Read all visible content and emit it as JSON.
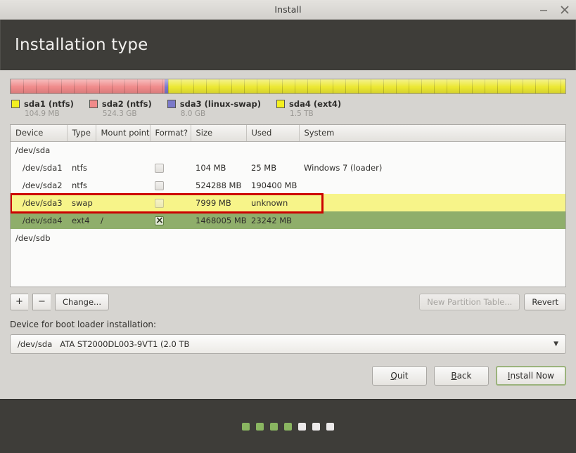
{
  "window": {
    "title": "Install",
    "controls": [
      {
        "name": "minimize",
        "glyph": "minimize-icon"
      },
      {
        "name": "close",
        "glyph": "close-icon"
      }
    ]
  },
  "header": {
    "title": "Installation type"
  },
  "partition_bar": {
    "segments": [
      {
        "id": "sda2",
        "color": "#f08a8a",
        "percent": 27.8
      },
      {
        "id": "sda3",
        "color": "#7b79c9",
        "percent": 0.55
      },
      {
        "id": "sda4",
        "color": "#ece832",
        "percent": 71.65
      }
    ]
  },
  "legend": [
    {
      "label": "sda1 (ntfs)",
      "size": "104.9 MB",
      "color": "#f4f01f"
    },
    {
      "label": "sda2 (ntfs)",
      "size": "524.3 GB",
      "color": "#f08a8a"
    },
    {
      "label": "sda3 (linux-swap)",
      "size": "8.0 GB",
      "color": "#7b79c9"
    },
    {
      "label": "sda4 (ext4)",
      "size": "1.5 TB",
      "color": "#f4f01f"
    }
  ],
  "table": {
    "columns": [
      "Device",
      "Type",
      "Mount point",
      "Format?",
      "Size",
      "Used",
      "System"
    ],
    "rows": [
      {
        "kind": "disk",
        "device": "/dev/sda",
        "type": "",
        "mount": "",
        "format": null,
        "size": "",
        "used": "",
        "system": ""
      },
      {
        "kind": "partition",
        "device": "/dev/sda1",
        "type": "ntfs",
        "mount": "",
        "format": false,
        "size": "104 MB",
        "used": "25 MB",
        "system": "Windows 7 (loader)"
      },
      {
        "kind": "partition",
        "device": "/dev/sda2",
        "type": "ntfs",
        "mount": "",
        "format": false,
        "size": "524288 MB",
        "used": "190400 MB",
        "system": ""
      },
      {
        "kind": "partition",
        "device": "/dev/sda3",
        "type": "swap",
        "mount": "",
        "format": false,
        "size": "7999 MB",
        "used": "unknown",
        "system": "",
        "state": "highlight"
      },
      {
        "kind": "partition",
        "device": "/dev/sda4",
        "type": "ext4",
        "mount": "/",
        "format": true,
        "size": "1468005 MB",
        "used": "23242 MB",
        "system": "",
        "state": "selected"
      },
      {
        "kind": "disk",
        "device": "/dev/sdb",
        "type": "",
        "mount": "",
        "format": null,
        "size": "",
        "used": "",
        "system": ""
      }
    ],
    "annotation_color": "#cc0000"
  },
  "toolbar": {
    "add_label": "+",
    "remove_label": "−",
    "change_label": "Change...",
    "new_partition_table_label": "New Partition Table...",
    "new_partition_table_enabled": false,
    "revert_label": "Revert"
  },
  "boot_loader": {
    "label": "Device for boot loader installation:",
    "selected_device": "/dev/sda",
    "selected_description": "ATA ST2000DL003-9VT1 (2.0 TB"
  },
  "actions": {
    "quit": {
      "prefix": "Q",
      "rest": "uit"
    },
    "back": {
      "prefix": "B",
      "rest": "ack"
    },
    "install_now": {
      "prefix": "I",
      "rest": "nstall Now"
    }
  },
  "progress_dots": {
    "total": 7,
    "completed": 4,
    "done_color": "#8ab661",
    "todo_color": "#eceaea"
  }
}
